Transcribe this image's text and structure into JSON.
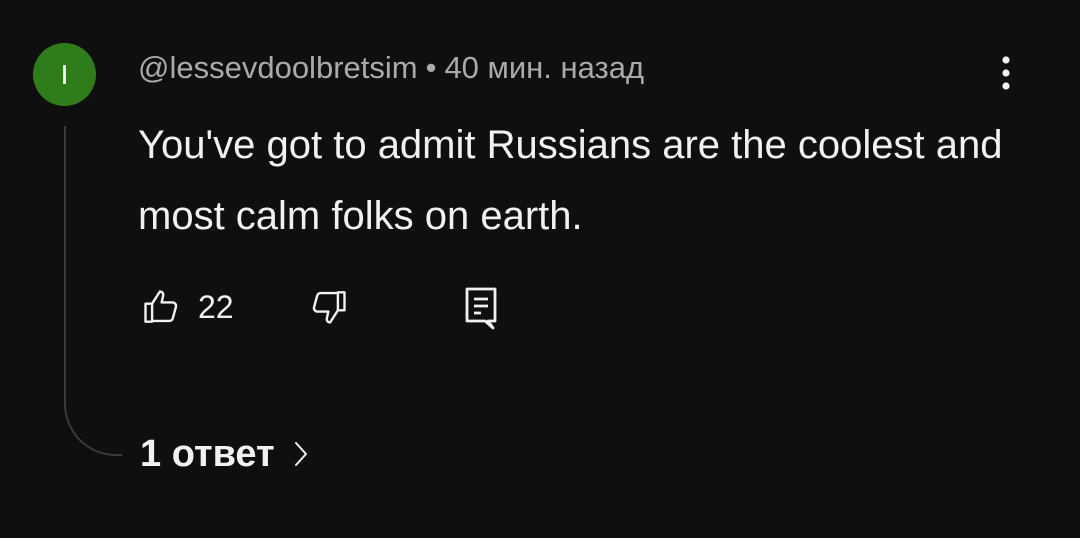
{
  "comment": {
    "avatar_letter": "I",
    "avatar_color": "#2f7d1a",
    "author": "@lessevdoolbretsim",
    "separator": "•",
    "time": "40 мин. назад",
    "text": "You've got to admit Russians are the coolest and most calm folks on earth.",
    "like_count": "22",
    "replies_label": "1 ответ"
  },
  "icons": {
    "like": "thumbs-up-icon",
    "dislike": "thumbs-down-icon",
    "reply": "reply-comment-icon",
    "menu": "more-vertical-icon",
    "replies_chevron": "chevron-right-icon"
  }
}
